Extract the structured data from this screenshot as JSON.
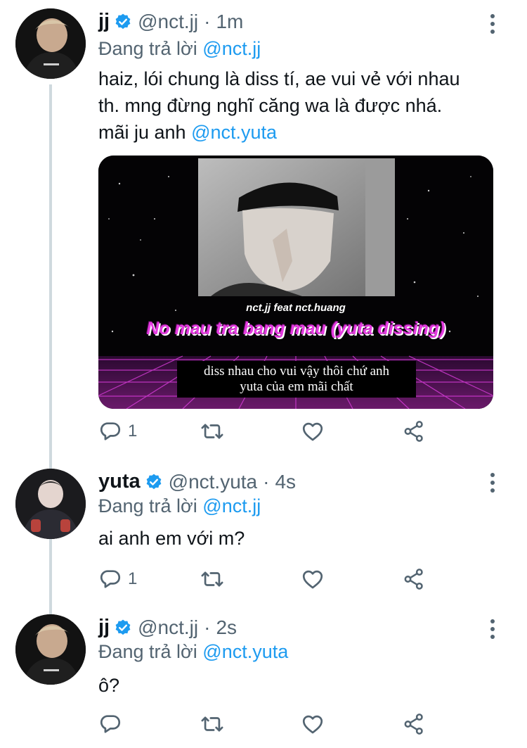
{
  "tweets": [
    {
      "name": "jj",
      "handle": "@nct.jj",
      "time": "1m",
      "reply_prefix": "Đang trả lời",
      "reply_to": "@nct.jj",
      "text_lines": [
        "haiz, lói chung là diss tí, ae vui vẻ với nhau",
        "th. mng đừng nghĩ căng wa là được nhá."
      ],
      "text_line3": "mãi ju anh",
      "mention": "@nct.yuta",
      "media": {
        "title": "nct.jj feat nct.huang",
        "subtitle": "No mau tra bang mau (yuta dissing)",
        "caption_1": "diss nhau cho vui vậy thôi chứ anh",
        "caption_2": "yuta của em mãi chất"
      },
      "reply_count": "1"
    },
    {
      "name": "yuta",
      "handle": "@nct.yuta",
      "time": "4s",
      "reply_prefix": "Đang trả lời",
      "reply_to": "@nct.jj",
      "text": "ai anh em với m?",
      "reply_count": "1"
    },
    {
      "name": "jj",
      "handle": "@nct.jj",
      "time": "2s",
      "reply_prefix": "Đang trả lời",
      "reply_to": "@nct.yuta",
      "text": "ô?",
      "reply_count": ""
    }
  ],
  "dot_separator": "·",
  "colors": {
    "link": "#1d9bf0",
    "secondary": "#536471",
    "thread_line": "#cfd9de",
    "media_title": "#e43be0"
  },
  "icons": [
    "verified-badge-icon",
    "more-options-icon",
    "reply-icon",
    "retweet-icon",
    "like-icon",
    "share-icon"
  ]
}
